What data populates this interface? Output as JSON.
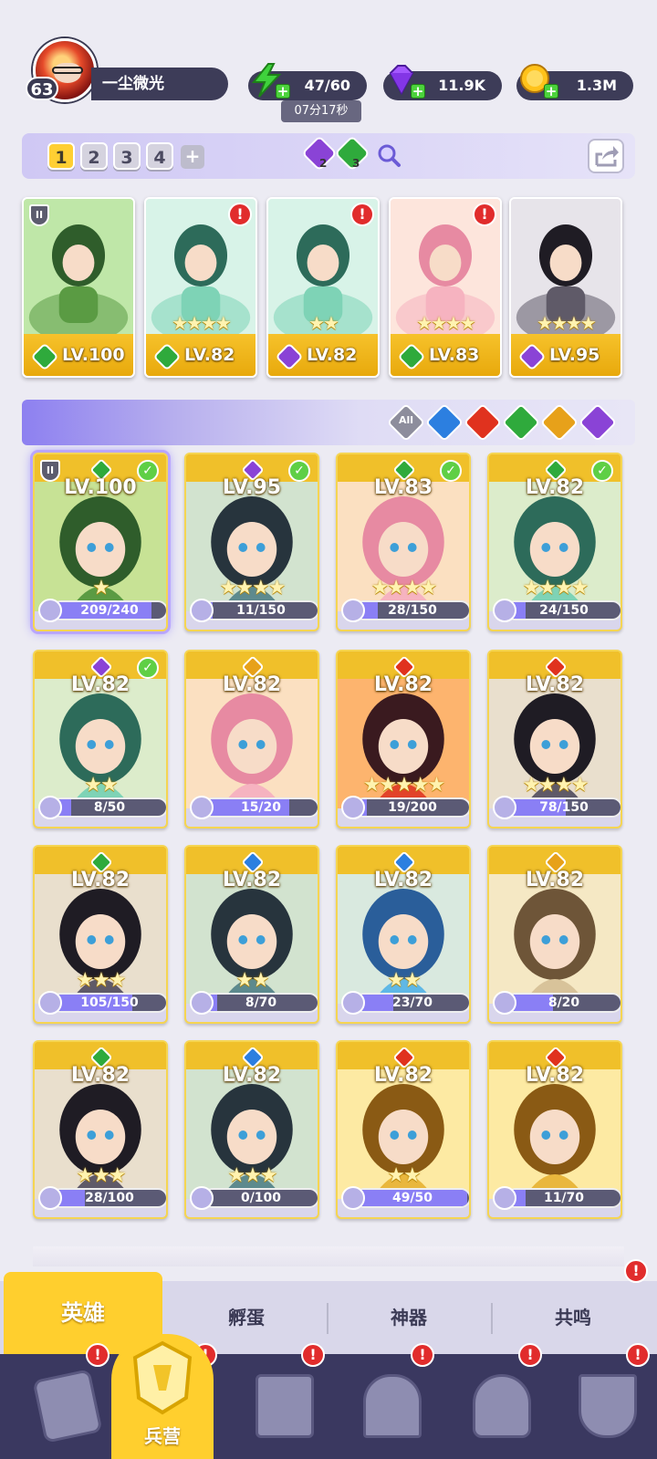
{
  "player": {
    "level": "63",
    "name": "一尘微光",
    "energy": "47/60",
    "energy_timer": "07分17秒",
    "gems": "11.9K",
    "gold": "1.3M"
  },
  "teams": {
    "tabs": [
      "1",
      "2",
      "3",
      "4"
    ],
    "active": "1",
    "counts": [
      "2",
      "3"
    ]
  },
  "lineup": [
    {
      "level": "LV.100",
      "stars": "",
      "element": "nature",
      "alert": false,
      "tier": "II"
    },
    {
      "level": "LV.82",
      "stars": "★★★★",
      "element": "nature",
      "alert": true
    },
    {
      "level": "LV.82",
      "stars": "★★",
      "element": "dark",
      "alert": true
    },
    {
      "level": "LV.83",
      "stars": "★★★★",
      "element": "nature",
      "alert": true
    },
    {
      "level": "LV.95",
      "stars": "★★★★",
      "element": "dark",
      "alert": false
    }
  ],
  "filters": {
    "all_label": "All",
    "elements": [
      "water",
      "fire",
      "nature",
      "light",
      "dark"
    ]
  },
  "heroes": [
    {
      "level": "LV.100",
      "frag": "209/240",
      "progress": 0.87,
      "element": "nature",
      "check": true,
      "stars": "★",
      "tier": "II",
      "art": "green"
    },
    {
      "level": "LV.95",
      "frag": "11/150",
      "progress": 0.07,
      "element": "dark",
      "check": true,
      "stars": "★★★★",
      "art": "teal"
    },
    {
      "level": "LV.83",
      "frag": "28/150",
      "progress": 0.19,
      "element": "nature",
      "check": true,
      "stars": "★★★★",
      "art": "pink"
    },
    {
      "level": "LV.82",
      "frag": "24/150",
      "progress": 0.16,
      "element": "nature",
      "check": true,
      "stars": "★★★★",
      "art": "mint"
    },
    {
      "level": "LV.82",
      "frag": "8/50",
      "progress": 0.16,
      "element": "dark",
      "check": true,
      "stars": "★★",
      "art": "mint"
    },
    {
      "level": "LV.82",
      "frag": "15/20",
      "progress": 0.75,
      "element": "light",
      "check": false,
      "stars": "",
      "art": "pink"
    },
    {
      "level": "LV.82",
      "frag": "19/200",
      "progress": 0.1,
      "element": "fire",
      "check": false,
      "stars": "★★★★★",
      "art": "red"
    },
    {
      "level": "LV.82",
      "frag": "78/150",
      "progress": 0.52,
      "element": "fire",
      "check": false,
      "stars": "★★★★",
      "art": "dark"
    },
    {
      "level": "LV.82",
      "frag": "105/150",
      "progress": 0.7,
      "element": "nature",
      "check": false,
      "stars": "★★★",
      "art": "dark"
    },
    {
      "level": "LV.82",
      "frag": "8/70",
      "progress": 0.11,
      "element": "water",
      "check": false,
      "stars": "★★",
      "art": "teal"
    },
    {
      "level": "LV.82",
      "frag": "23/70",
      "progress": 0.33,
      "element": "water",
      "check": false,
      "stars": "★★",
      "art": "blue"
    },
    {
      "level": "LV.82",
      "frag": "8/20",
      "progress": 0.4,
      "element": "light",
      "check": false,
      "stars": "",
      "art": "cream"
    },
    {
      "level": "LV.82",
      "frag": "28/100",
      "progress": 0.28,
      "element": "nature",
      "check": false,
      "stars": "★★★",
      "art": "dark"
    },
    {
      "level": "LV.82",
      "frag": "0/100",
      "progress": 0.0,
      "element": "water",
      "check": false,
      "stars": "★★★",
      "art": "teal"
    },
    {
      "level": "LV.82",
      "frag": "49/50",
      "progress": 0.98,
      "element": "fire",
      "check": false,
      "stars": "★★",
      "art": "gold"
    },
    {
      "level": "LV.82",
      "frag": "11/70",
      "progress": 0.16,
      "element": "fire",
      "check": false,
      "stars": "",
      "art": "gold"
    }
  ],
  "subtabs": [
    "英雄",
    "孵蛋",
    "神器",
    "共鸣"
  ],
  "nav": {
    "active_label": "兵营"
  },
  "colors": {
    "nature": "#2faa3c",
    "dark": "#8a43d6",
    "fire": "#e0321e",
    "water": "#2c7fe0",
    "light": "#e7a11a",
    "accent": "#ffcf2e",
    "panel": "#3d3c58"
  }
}
